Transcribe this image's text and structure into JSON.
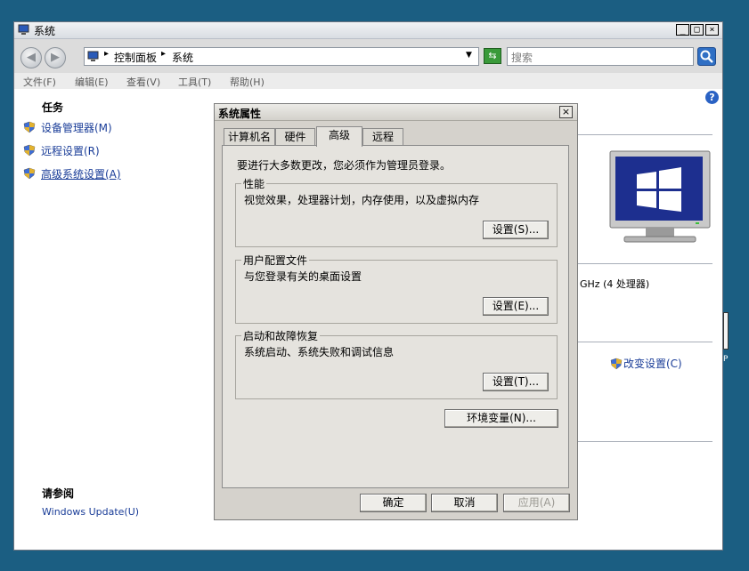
{
  "window": {
    "title": "系统",
    "controls": {
      "minimize": "_",
      "maximize": "□",
      "close": "×"
    }
  },
  "address_bar": {
    "crumb_root": "控制面板",
    "crumb_current": "系统",
    "search_placeholder": "搜索"
  },
  "menu": [
    "文件(F)",
    "编辑(E)",
    "查看(V)",
    "工具(T)",
    "帮助(H)"
  ],
  "sidebar": {
    "tasks_heading": "任务",
    "tasks": [
      "设备管理器(M)",
      "远程设置(R)",
      "高级系统设置(A)"
    ],
    "see_also_heading": "请参阅",
    "see_also": [
      "Windows Update(U)"
    ]
  },
  "background_panel": {
    "cpu_info": "GHz  (4 处理器)",
    "change_settings": "改变设置(C)",
    "cutoff_text": "P"
  },
  "dialog": {
    "title": "系统属性",
    "close": "×",
    "tabs": [
      {
        "label": "计算机名",
        "selected": false
      },
      {
        "label": "硬件",
        "selected": false
      },
      {
        "label": "高级",
        "selected": true
      },
      {
        "label": "远程",
        "selected": false
      }
    ],
    "admin_note": "要进行大多数更改，您必须作为管理员登录。",
    "groups": [
      {
        "title": "性能",
        "description": "视觉效果，处理器计划，内存使用，以及虚拟内存",
        "button": "设置(S)..."
      },
      {
        "title": "用户配置文件",
        "description": "与您登录有关的桌面设置",
        "button": "设置(E)..."
      },
      {
        "title": "启动和故障恢复",
        "description": "系统启动、系统失败和调试信息",
        "button": "设置(T)..."
      }
    ],
    "env_button": "环境变量(N)...",
    "ok": "确定",
    "cancel": "取消",
    "apply": "应用(A)"
  },
  "colors": {
    "desktop": "#1b5e82",
    "link": "#1a3d98",
    "search_go": "#2f6fc4",
    "refresh": "#3a9a3a"
  }
}
